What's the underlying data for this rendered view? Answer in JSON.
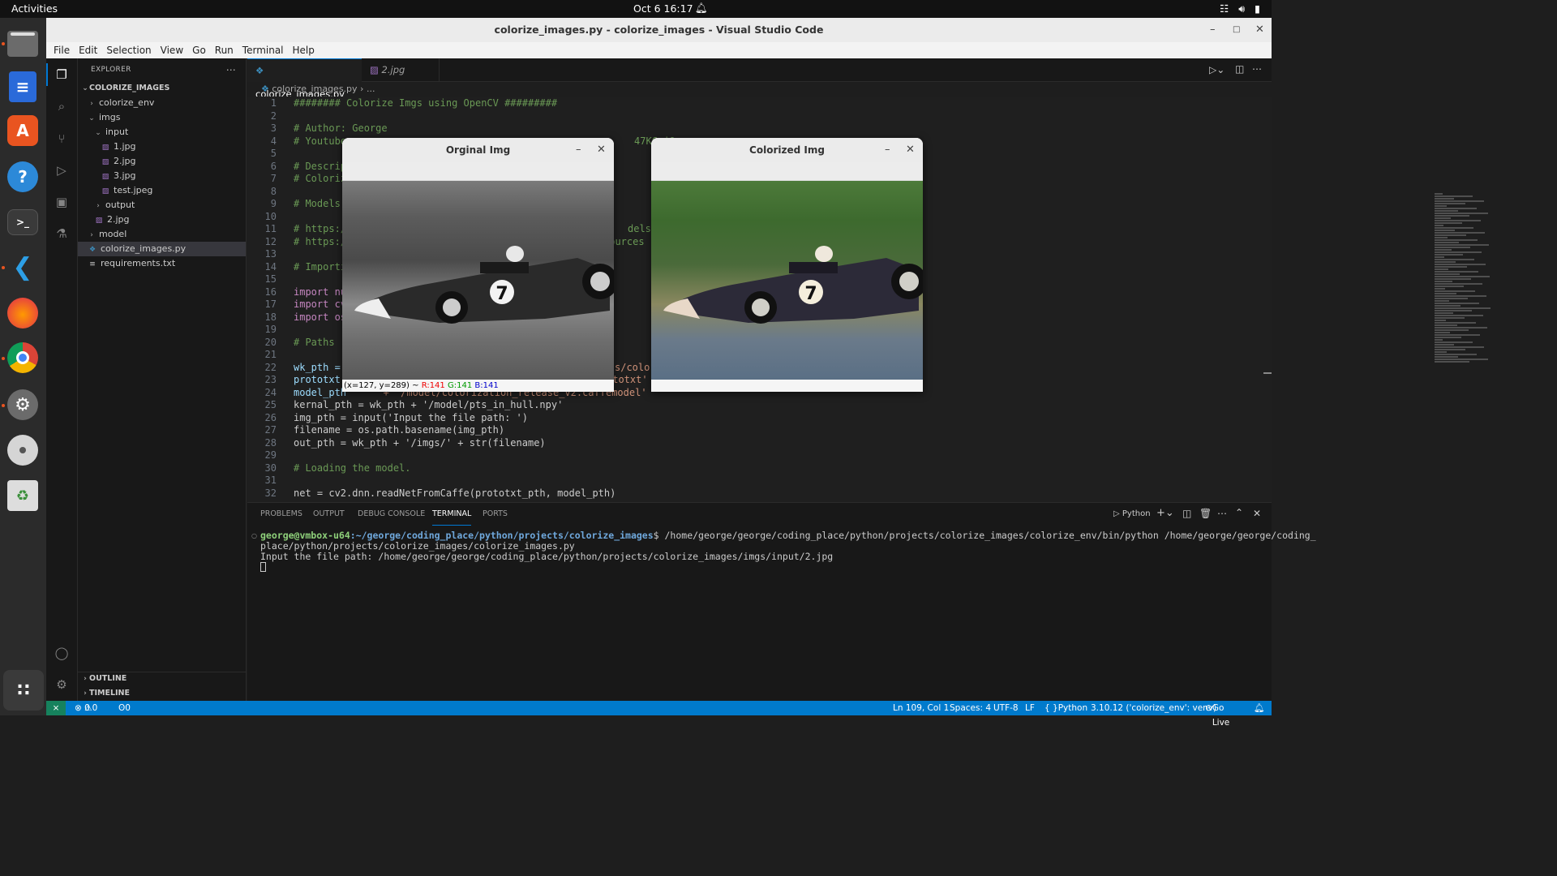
{
  "topbar": {
    "activities": "Activities",
    "clock": "Oct 6  16:17"
  },
  "window": {
    "title": "colorize_images.py - colorize_images - Visual Studio Code"
  },
  "menu": [
    "File",
    "Edit",
    "Selection",
    "View",
    "Go",
    "Run",
    "Terminal",
    "Help"
  ],
  "explorer": {
    "header": "EXPLORER",
    "root": "COLORIZE_IMAGES",
    "items": [
      {
        "label": "colorize_env",
        "type": "folder",
        "open": false,
        "depth": 1
      },
      {
        "label": "imgs",
        "type": "folder",
        "open": true,
        "depth": 1
      },
      {
        "label": "input",
        "type": "folder",
        "open": true,
        "depth": 2
      },
      {
        "label": "1.jpg",
        "type": "image",
        "depth": 3
      },
      {
        "label": "2.jpg",
        "type": "image",
        "depth": 3
      },
      {
        "label": "3.jpg",
        "type": "image",
        "depth": 3
      },
      {
        "label": "test.jpeg",
        "type": "image",
        "depth": 3
      },
      {
        "label": "output",
        "type": "folder",
        "open": false,
        "depth": 2
      },
      {
        "label": "2.jpg",
        "type": "image",
        "depth": 2
      },
      {
        "label": "model",
        "type": "folder",
        "open": false,
        "depth": 1
      },
      {
        "label": "colorize_images.py",
        "type": "python",
        "depth": 1,
        "selected": true
      },
      {
        "label": "requirements.txt",
        "type": "text",
        "depth": 1
      }
    ],
    "outline": "OUTLINE",
    "timeline": "TIMELINE"
  },
  "tabs": [
    {
      "label": "colorize_images.py",
      "active": true
    },
    {
      "label": "2.jpg",
      "active": false
    }
  ],
  "breadcrumb": {
    "file": "colorize_images.py",
    "rest": "..."
  },
  "code": [
    {
      "n": "1",
      "t": "######## Colorize Imgs using OpenCV #########",
      "c": "cm"
    },
    {
      "n": "2",
      "t": ""
    },
    {
      "n": "3",
      "t": "# Author: George",
      "c": "cm"
    },
    {
      "n": "4",
      "t": "# Youtube",
      "c": "cm",
      "tail": "47KCqjO",
      "tailx": 420
    },
    {
      "n": "5",
      "t": ""
    },
    {
      "n": "6",
      "t": "# Descrip",
      "c": "cm"
    },
    {
      "n": "7",
      "t": "# Coloriz",
      "c": "cm"
    },
    {
      "n": "8",
      "t": ""
    },
    {
      "n": "9",
      "t": "# Models",
      "c": "cm"
    },
    {
      "n": "10",
      "t": ""
    },
    {
      "n": "11",
      "t": "# https:/",
      "c": "cm",
      "tail": "dels",
      "tailx": 412
    },
    {
      "n": "12",
      "t": "# https:/",
      "c": "cm",
      "tail": "sources",
      "tailx": 382
    },
    {
      "n": "13",
      "t": ""
    },
    {
      "n": "14",
      "t": "# Importi",
      "c": "cm"
    },
    {
      "n": "15",
      "t": ""
    },
    {
      "n": "16",
      "t": "import nu",
      "c": "kw"
    },
    {
      "n": "17",
      "t": "import cv",
      "c": "kw"
    },
    {
      "n": "18",
      "t": "import os",
      "c": "kw"
    },
    {
      "n": "19",
      "t": ""
    },
    {
      "n": "20",
      "t": "# Paths",
      "c": "cm"
    },
    {
      "n": "21",
      "t": ""
    },
    {
      "n": "22",
      "t": "wk_pth =",
      "c": "vr",
      "tail": "s/color",
      "tailx": 396
    },
    {
      "n": "23",
      "t": "prototxt",
      "c": "vr",
      "tail": "ototxt'",
      "tailx": 386
    },
    {
      "n": "24",
      "t": "model_pth",
      "c": "vr",
      "tail": "' + '/model/colorization_release_v2.caffemodel'",
      "tailx": 96
    },
    {
      "n": "25",
      "t": "kernal_pth = wk_pth + '/model/pts_in_hull.npy'"
    },
    {
      "n": "26",
      "t": "img_pth = input('Input the file path: ')"
    },
    {
      "n": "27",
      "t": "filename = os.path.basename(img_pth)"
    },
    {
      "n": "28",
      "t": "out_pth = wk_pth + '/imgs/' + str(filename)"
    },
    {
      "n": "29",
      "t": ""
    },
    {
      "n": "30",
      "t": "# Loading the model.",
      "c": "cm"
    },
    {
      "n": "31",
      "t": ""
    },
    {
      "n": "32",
      "t": "net = cv2.dnn.readNetFromCaffe(prototxt_pth, model_pth)"
    }
  ],
  "panel": {
    "tabs": [
      "PROBLEMS",
      "OUTPUT",
      "DEBUG CONSOLE",
      "TERMINAL",
      "PORTS"
    ],
    "active_tab": "TERMINAL",
    "shell_label": "Python",
    "prompt_user": "george@vmbox-u64",
    "prompt_path": ":~/george/coding_place/python/projects/colorize_images",
    "cmd1": "$ /home/george/george/coding_place/python/projects/colorize_images/colorize_env/bin/python /home/george/george/coding_",
    "cmd2": "place/python/projects/colorize_images/colorize_images.py",
    "out1": "Input the file path: /home/george/george/coding_place/python/projects/colorize_images/imgs/input/2.jpg"
  },
  "statusbar": {
    "errors": "0",
    "warnings": "0",
    "ports": "0",
    "pos": "Ln 109, Col 1",
    "spaces": "Spaces: 4",
    "enc": "UTF-8",
    "eol": "LF",
    "lang": "Python",
    "interp": "3.10.12 ('colorize_env': venv)",
    "golive": "Go Live"
  },
  "win_orig": {
    "title": "Orginal Img",
    "coords": "(x=127, y=289) ~",
    "r": "R:141",
    "g": "G:141",
    "b": "B:141",
    "car_number": "7"
  },
  "win_color": {
    "title": "Colorized Img",
    "car_number": "7"
  },
  "colors": {
    "accent": "#007acc",
    "brand": "#e95420"
  }
}
